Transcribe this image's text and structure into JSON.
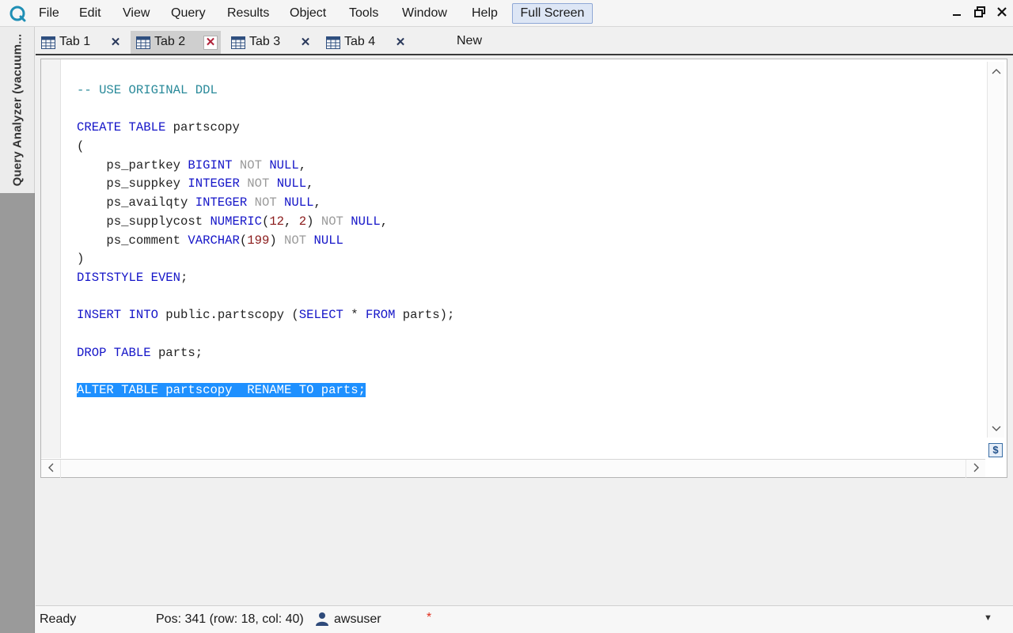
{
  "menubar": {
    "items": [
      "File",
      "Edit",
      "View",
      "Query",
      "Results",
      "Object",
      "Tools",
      "Window",
      "Help"
    ],
    "fullscreen_label": "Full Screen"
  },
  "window_controls": {
    "minimize": "▬",
    "restore": "❐",
    "close": "✕"
  },
  "sidebar": {
    "panel_label": "Query Analyzer (vacuum..."
  },
  "tabs": [
    {
      "label": "Tab 1",
      "active": false
    },
    {
      "label": "Tab 2",
      "active": true
    },
    {
      "label": "Tab 3",
      "active": false
    },
    {
      "label": "Tab 4",
      "active": false
    }
  ],
  "new_tab_label": "New",
  "editor": {
    "lines": [
      "-- USE ORIGINAL DDL",
      "",
      "CREATE TABLE partscopy",
      "(",
      "    ps_partkey BIGINT NOT NULL,",
      "    ps_suppkey INTEGER NOT NULL,",
      "    ps_availqty INTEGER NOT NULL,",
      "    ps_supplycost NUMERIC(12, 2) NOT NULL,",
      "    ps_comment VARCHAR(199) NOT NULL",
      ")",
      "DISTSTYLE EVEN;",
      "",
      "INSERT INTO public.partscopy (SELECT * FROM parts);",
      "",
      "DROP TABLE parts;",
      "",
      "ALTER TABLE partscopy  RENAME TO parts;"
    ],
    "selected_line_index": 16,
    "colors": {
      "keyword": "#1515c8",
      "null_keyword": "#9a9a9a",
      "number": "#8a1a1a",
      "comment": "#2a8a9a",
      "selection": "#1e90ff"
    }
  },
  "status": {
    "state": "Ready",
    "position": "Pos: 341 (row: 18, col: 40)",
    "user": "awsuser",
    "modified_marker": "*"
  },
  "icons": {
    "app": "app-logo-icon",
    "tab": "table-grid-icon",
    "close": "close-icon",
    "user": "user-icon",
    "split": "split-view-icon"
  }
}
